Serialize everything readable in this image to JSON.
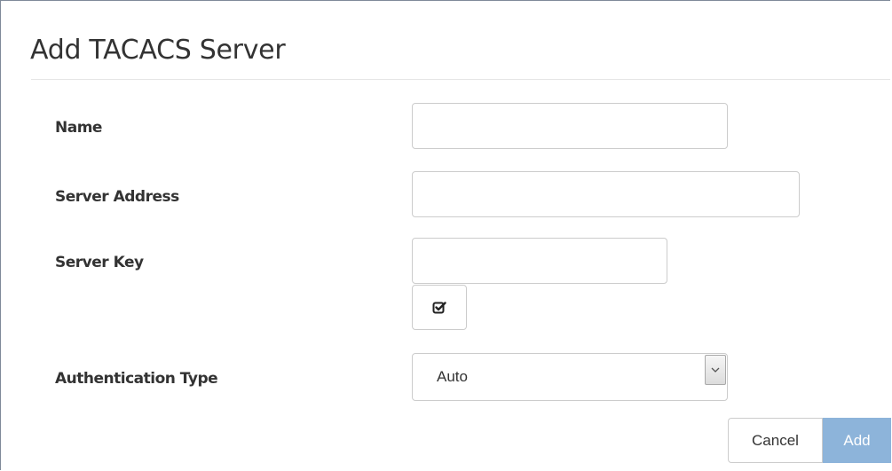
{
  "dialog": {
    "title": "Add TACACS Server"
  },
  "form": {
    "name": {
      "label": "Name",
      "value": ""
    },
    "server_address": {
      "label": "Server Address",
      "value": ""
    },
    "server_key": {
      "label": "Server Key",
      "value": "",
      "toggle_icon": "checkbox-checked-icon"
    },
    "authentication_type": {
      "label": "Authentication Type",
      "selected": "Auto"
    }
  },
  "actions": {
    "cancel_label": "Cancel",
    "add_label": "Add"
  },
  "colors": {
    "primary_button": "#8db4da",
    "text": "#333333",
    "border": "#cccccc"
  }
}
